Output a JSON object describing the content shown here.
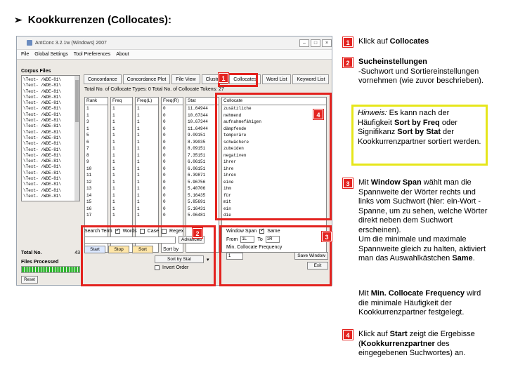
{
  "slide": {
    "title": "Kookkurrenzen (Collocates):"
  },
  "window": {
    "title": "AntConc 3.2.1w (Windows) 2007",
    "menu": [
      "File",
      "Global Settings",
      "Tool Preferences",
      "About"
    ],
    "corpus_files_label": "Corpus Files",
    "files": [
      "\\Text- /WDE-81\\",
      "\\Text- /WDE-81\\",
      "\\Text- /WDE-81\\",
      "\\Text- /WDE-81\\",
      "\\Text- /WDE-81\\",
      "\\Text- /WDE-81\\",
      "\\Text- /WDE-81\\",
      "\\Text- /WDE-81\\",
      "\\Text- /WDE-81\\",
      "\\Text- /WDE-81\\",
      "\\Text- /WDE-81\\",
      "\\Text- /WDE-81\\",
      "\\Text- /WDE-81\\",
      "\\Text- /WDE-81\\",
      "\\Text- /WDE-81\\",
      "\\Text- /WDE-81\\",
      "\\Text- /WDE-81\\",
      "\\Text- /WDE-81\\",
      "\\Text- /WDE-81\\",
      "\\Text- /WDE-81\\",
      "\\Text- /WDE-81\\"
    ],
    "total_no_label": "Total No.",
    "total_no_value": "43",
    "files_processed_label": "Files Processed",
    "reset_label": "Reset",
    "tabs": [
      "Concordance",
      "Concordance Plot",
      "File View",
      "Clusters",
      "Collocates",
      "Word List",
      "Keyword List"
    ],
    "stats_text": "Total No. of Collocate Types: 0     Total No. of Collocate Tokens: 27",
    "columns": [
      "Rank",
      "Freq",
      "Freq(L)",
      "Freq(R)",
      "Stat",
      "Collocate"
    ],
    "rank": [
      "1",
      "1",
      "3",
      "1",
      "5",
      "6",
      "7",
      "8",
      "9",
      "10",
      "11",
      "12",
      "13",
      "14",
      "15",
      "16",
      "17"
    ],
    "freq": [
      "1",
      "1",
      "1",
      "1",
      "1",
      "1",
      "1",
      "1",
      "1",
      "1",
      "1",
      "1",
      "1",
      "1",
      "1",
      "1",
      "1"
    ],
    "freq_l": [
      "1",
      "1",
      "1",
      "1",
      "1",
      "1",
      "1",
      "1",
      "1",
      "1",
      "1",
      "1",
      "1",
      "1",
      "1",
      "1",
      "1"
    ],
    "freq_r": [
      "0",
      "0",
      "0",
      "0",
      "0",
      "0",
      "0",
      "0",
      "0",
      "0",
      "0",
      "0",
      "0",
      "0",
      "0",
      "0",
      "0"
    ],
    "stat": [
      "11.64944",
      "10.67344",
      "10.67344",
      "11.64944",
      "9.09151",
      "8.39035",
      "8.09151",
      "7.35151",
      "6.06151",
      "6.06151",
      "6.39871",
      "5.96756",
      "5.40706",
      "5.16435",
      "5.85691",
      "5.16431",
      "5.06481"
    ],
    "collocate": [
      "zusätzliche",
      "nehmend",
      "aufnahmefähigen",
      "dämpfende",
      "temporäre",
      "schwächere",
      "zubeiden",
      "negativen",
      "ihrer",
      "ihre",
      "ihren",
      "eine",
      "ihm",
      "für",
      "mit",
      "ein",
      "die"
    ],
    "search_term_label": "Search Term",
    "words_label": "Words",
    "case_label": "Case",
    "regex_label": "Regex",
    "advanced_label": "Advanced",
    "start_label": "Start",
    "stop_label": "Stop",
    "sort_label": "Sort",
    "sort_by_label": "Sort by",
    "sort_by_value": "Sort by Stat",
    "invert_order_label": "Invert Order",
    "window_span_label": "Window Span",
    "same_label": "Same",
    "span_left": "1L",
    "span_right": "1R",
    "to_label": "To",
    "min_freq_label": "Min. Collocate Frequency",
    "min_freq_value": "1",
    "save_window_label": "Save Window",
    "exit_label": "Exit"
  },
  "badges": {
    "b1": "1",
    "b2": "2",
    "b3": "3",
    "b4": "4"
  },
  "notes": {
    "n1_num": "1",
    "n1_pre": "Klick auf ",
    "n1_bold": "Collocates",
    "n2_num": "2",
    "n2_bold": "Sucheinstellungen",
    "n2_text": "-Suchwort und Sortiereinstellungen vornehmen (wie zuvor beschrieben).",
    "hint_label": "Hinweis:",
    "hint_pre": " Es kann nach der Häufigkeit ",
    "hint_b1": "Sort by Freq",
    "hint_mid": " oder Signifikanz  ",
    "hint_b2": "Sort by Stat",
    "hint_post": " der Kookkurrenzpartner sortiert werden.",
    "n3_num": "3",
    "n3_pre": "Mit ",
    "n3_bold": "Window Span",
    "n3_text": " wählt man die Spannweite der Wörter rechts und links vom Suchwort (hier:  ein-Wort -Spanne, um zu sehen, welche Wörter direkt neben dem Suchwort erscheinen).",
    "n3_text2": "Um die minimale und maximale Spannweite gleich zu halten, aktiviert man das Auswahlkästchen ",
    "n3_bold2": "Same",
    "n3_end": ".",
    "minfreq_pre": "Mit ",
    "minfreq_bold": "Min. Collocate Frequency",
    "minfreq_text": " wird die minimale Häufigkeit der Kookkurrenzpartner festgelegt.",
    "n4_num": "4",
    "n4_pre": "Klick auf ",
    "n4_bold": "Start",
    "n4_mid": " zeigt die Ergebisse (",
    "n4_bold2": "Kookkurrenzpartner",
    "n4_text": " des eingegebenen Suchwortes) an."
  },
  "colors": {
    "annotation_red": "#e3231f",
    "hint_border": "#e6e61a"
  }
}
